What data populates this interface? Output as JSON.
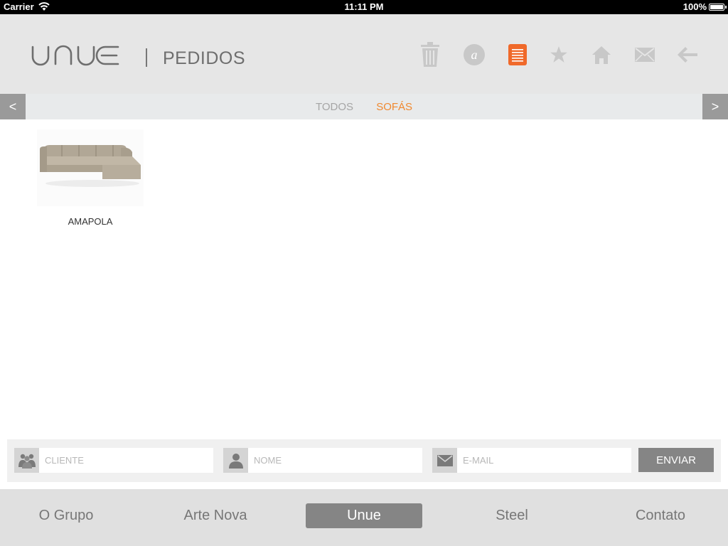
{
  "status_bar": {
    "carrier": "Carrier",
    "time": "11:11 PM",
    "battery": "100%"
  },
  "header": {
    "logo_text": "UNUE",
    "title": "PEDIDOS",
    "icons": [
      "trash-icon",
      "a-icon",
      "document-icon",
      "star-icon",
      "home-icon",
      "mail-icon",
      "back-arrow-icon"
    ],
    "active_icon": "document-icon",
    "accent_color": "#f0692a"
  },
  "filter_bar": {
    "prev": "<",
    "next": ">",
    "tabs": [
      {
        "label": "TODOS",
        "active": false
      },
      {
        "label": "SOFÁS",
        "active": true
      }
    ]
  },
  "products": [
    {
      "name": "AMAPOLA"
    }
  ],
  "form": {
    "cliente_placeholder": "CLIENTE",
    "nome_placeholder": "NOME",
    "email_placeholder": "E-MAIL",
    "send_label": "ENVIAR"
  },
  "bottom_nav": {
    "items": [
      {
        "label": "O Grupo",
        "active": false
      },
      {
        "label": "Arte Nova",
        "active": false
      },
      {
        "label": "Unue",
        "active": true
      },
      {
        "label": "Steel",
        "active": false
      },
      {
        "label": "Contato",
        "active": false
      }
    ]
  }
}
